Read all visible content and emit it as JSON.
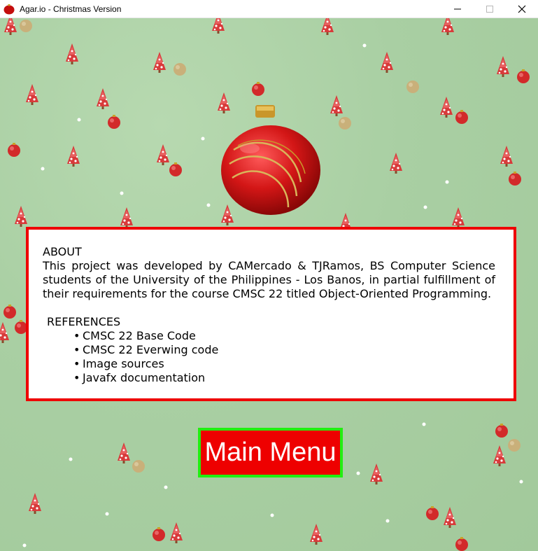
{
  "window": {
    "title": "Agar.io - Christmas Version",
    "icon": "red-ornament-icon",
    "controls": [
      "minimize-icon",
      "maximize-icon",
      "close-icon"
    ]
  },
  "about": {
    "title": "ABOUT",
    "body": "This project was developed by CAMercado & TJRamos, BS Computer Science students of the University of the Philippines - Los Banos, in partial fulfillment of their requirements for the course CMSC 22 titled Object-Oriented Programming.",
    "references_title": "REFERENCES",
    "references": [
      "CMSC 22 Base Code",
      "CMSC 22 Everwing code",
      "Image sources",
      "Javafx documentation"
    ]
  },
  "main_menu_button": {
    "label": "Main Menu"
  },
  "colors": {
    "background": "#a9cfa3",
    "panel_border": "#ee0000",
    "button_fill": "#ee0000",
    "button_border": "#22ee11",
    "button_text": "#ffffff"
  }
}
